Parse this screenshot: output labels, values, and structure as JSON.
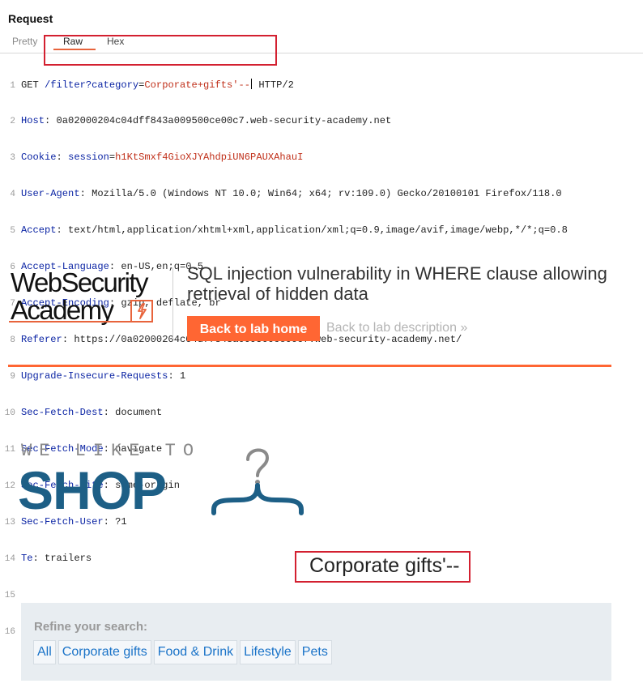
{
  "request": {
    "title": "Request",
    "tabs": [
      "Pretty",
      "Raw",
      "Hex"
    ],
    "lines": [
      {
        "n": "1",
        "method": "GET ",
        "path": "/filter?",
        "param_key": "category",
        "eq": "=",
        "param_val": "Corporate+gifts'--",
        "proto": " HTTP/2"
      },
      {
        "n": "2",
        "key": "Host",
        "value": ": 0a02000204c04dff843a009500ce00c7.web-security-academy.net"
      },
      {
        "n": "3",
        "key": "Cookie",
        "value": ": ",
        "ckey": "session",
        "ceq": "=",
        "cval": "h1KtSmxf4GioXJYAhdpiUN6PAUXAhauI"
      },
      {
        "n": "4",
        "key": "User-Agent",
        "value": ": Mozilla/5.0 (Windows NT 10.0; Win64; x64; rv:109.0) Gecko/20100101 Firefox/118.0"
      },
      {
        "n": "5",
        "key": "Accept",
        "value": ": text/html,application/xhtml+xml,application/xml;q=0.9,image/avif,image/webp,*/*;q=0.8"
      },
      {
        "n": "6",
        "key": "Accept-Language",
        "value": ": en-US,en;q=0.5"
      },
      {
        "n": "7",
        "key": "Accept-Encoding",
        "value": ": gzip, deflate, br"
      },
      {
        "n": "8",
        "key": "Referer",
        "value": ": https://0a02000204c04dff843a009500ce00c7.web-security-academy.net/"
      },
      {
        "n": "9",
        "key": "Upgrade-Insecure-Requests",
        "value": ": 1"
      },
      {
        "n": "10",
        "key": "Sec-Fetch-Dest",
        "value": ": document"
      },
      {
        "n": "11",
        "key": "Sec-Fetch-Mode",
        "value": ": navigate"
      },
      {
        "n": "12",
        "key": "Sec-Fetch-Site",
        "value": ": same-origin"
      },
      {
        "n": "13",
        "key": "Sec-Fetch-User",
        "value": ": ?1"
      },
      {
        "n": "14",
        "key": "Te",
        "value": ": trailers"
      },
      {
        "n": "15"
      },
      {
        "n": "16"
      }
    ]
  },
  "academy": {
    "logo_line1": "WebSecurity",
    "logo_line2": "Academy",
    "lab_title": "SQL injection vulnerability in WHERE clause allowing retrieval of hidden data",
    "back_home": "Back to lab home",
    "back_desc": "Back to lab description",
    "back_desc_chevron": "»",
    "accent": "#ff6633"
  },
  "shop": {
    "tagline": "WE LIKE TO",
    "brand": "SHOP",
    "brand_color": "#1d5f86",
    "category_title": "Corporate gifts'--",
    "refine_label": "Refine your search:",
    "filters": [
      "All",
      "Corporate gifts",
      "Food & Drink",
      "Lifestyle",
      "Pets"
    ]
  }
}
